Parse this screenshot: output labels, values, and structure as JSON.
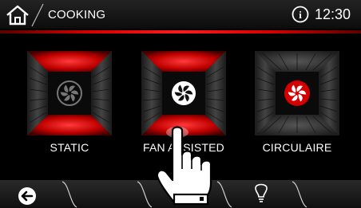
{
  "header": {
    "title": "COOKING",
    "time": "12:30",
    "icons": [
      "home-icon",
      "info-icon"
    ]
  },
  "modes": [
    {
      "label": "STATIC",
      "state": "unselected",
      "icon": "fan-icon"
    },
    {
      "label": "FAN ASSISTED",
      "state": "selected",
      "icon": "fan-icon"
    },
    {
      "label": "CIRCULAIRE",
      "state": "unselected",
      "icon": "fan-icon"
    }
  ],
  "bottom_bar": {
    "icons": [
      "back-icon",
      "lightbulb-icon"
    ]
  },
  "colors": {
    "accent": "#e00000",
    "background": "#000000",
    "text": "#ffffff"
  }
}
